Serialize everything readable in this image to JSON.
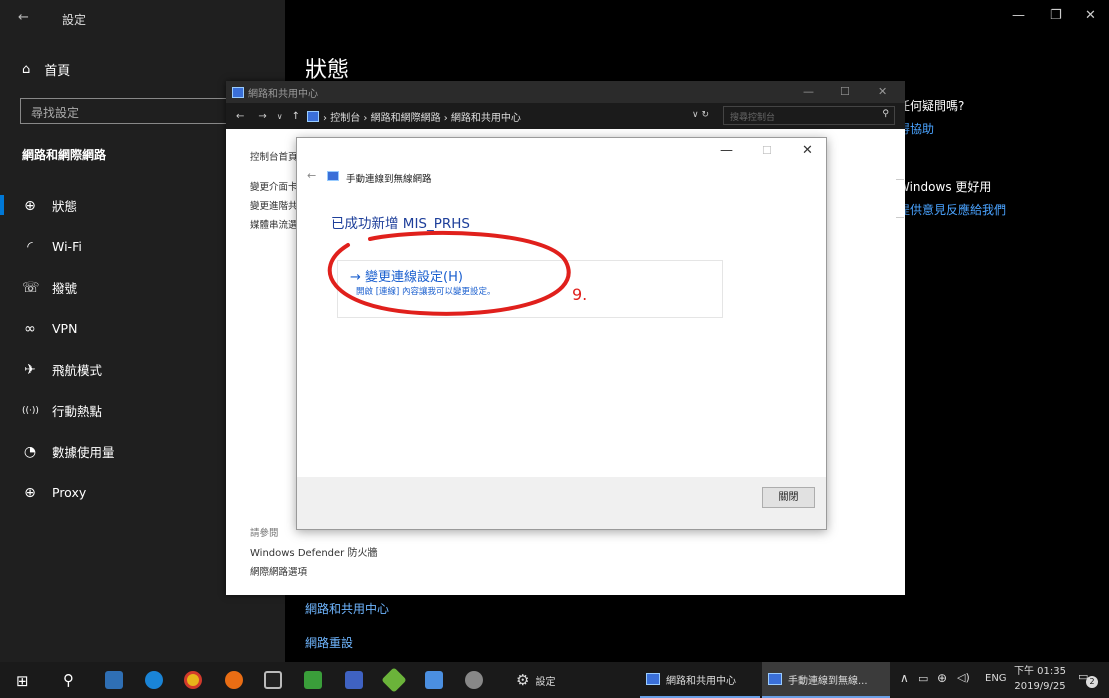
{
  "settings": {
    "title": "設定",
    "home": "首頁",
    "search_placeholder": "尋找設定",
    "section": "網路和網際網路",
    "nav": [
      {
        "icon": "globe-icon",
        "glyph": "⊕",
        "label": "狀態"
      },
      {
        "icon": "wifi-icon",
        "glyph": "◜",
        "label": "Wi-Fi"
      },
      {
        "icon": "dialup-icon",
        "glyph": "☏",
        "label": "撥號"
      },
      {
        "icon": "vpn-icon",
        "glyph": "∞",
        "label": "VPN"
      },
      {
        "icon": "airplane-icon",
        "glyph": "✈",
        "label": "飛航模式"
      },
      {
        "icon": "hotspot-icon",
        "glyph": "((·))",
        "label": "行動熱點"
      },
      {
        "icon": "data-usage-icon",
        "glyph": "◔",
        "label": "數據使用量"
      },
      {
        "icon": "proxy-icon",
        "glyph": "⊕",
        "label": "Proxy"
      }
    ],
    "page_title": "狀態",
    "right_q": "任何疑問嗎?",
    "right_help": "得協助",
    "right_better": "Windows 更好用",
    "right_feedback": "提供意見反應給我們",
    "bottom_link1": "網路和共用中心",
    "bottom_link2": "網路重設"
  },
  "control_panel": {
    "title": "網路和共用中心",
    "breadcrumb": "› 控制台 › 網路和網際網路 › 網路和共用中心",
    "search_placeholder": "搜尋控制台",
    "side_home": "控制台首頁",
    "side_items": [
      "變更介面卡設定",
      "變更進階共用設定",
      "媒體串流選項"
    ],
    "see_also": "請參閱",
    "see_also_items": [
      "Windows Defender 防火牆",
      "網際網路選項"
    ]
  },
  "dialog": {
    "title": "手動連線到無線網路",
    "success": "已成功新增 MIS_PRHS",
    "link_title": "→ 變更連線設定(H)",
    "link_desc": "開啟 [連線] 內容讓我可以變更設定。",
    "annotation": "9.",
    "close_button": "關閉"
  },
  "taskbar": {
    "settings_label": "設定",
    "task1": "網路和共用中心",
    "task2": "手動連線到無線...",
    "lang": "ENG",
    "time": "下午 01:35",
    "date": "2019/9/25",
    "notif": "2"
  }
}
